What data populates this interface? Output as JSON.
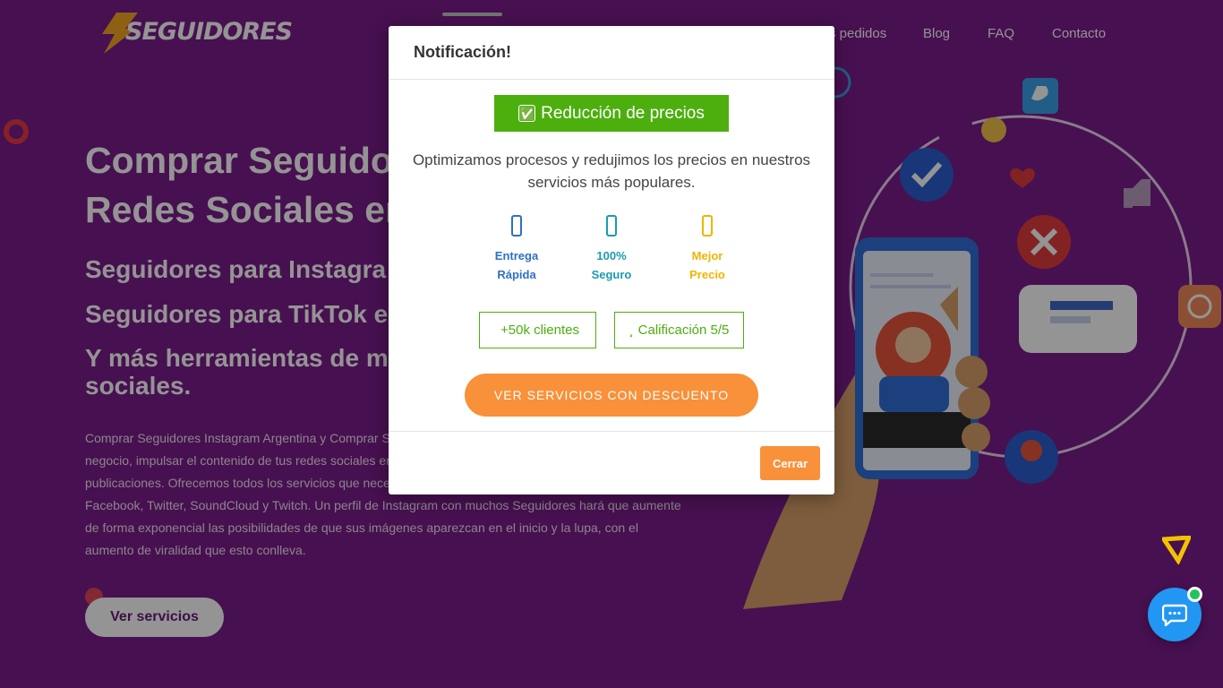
{
  "brand": {
    "logo_text": "SEGUIDORES"
  },
  "nav": {
    "items": [
      "s pedidos",
      "Blog",
      "FAQ",
      "Contacto"
    ]
  },
  "hero": {
    "title_line1": "Comprar Seguidor",
    "title_line2": "Redes Sociales en",
    "sub1": "Seguidores para Instagra",
    "sub2": "Seguidores para TikTok e",
    "sub3a": "Y más herramientas de m",
    "sub3b": "sociales.",
    "paragraph_lines": [
      "Comprar Seguidores Instagram Argentina y Comprar S",
      "negocio, impulsar el contenido de tus redes sociales en",
      "publicaciones. Ofrecemos todos los servicios que nece",
      "Facebook, Twitter, SoundCloud y Twitch. Un perfil de Instagram con muchos Seguidores hará que aumente",
      "de forma exponencial las posibilidades de que sus imágenes aparezcan en el inicio y la lupa, con el",
      "aumento de viralidad que esto conlleva."
    ],
    "button_label": "Ver servicios"
  },
  "modal": {
    "title": "Notificación!",
    "close_glyph": "",
    "badge_emoji": "✅",
    "badge_label": "Reducción de precios",
    "text": "Optimizamos procesos y redujimos los precios en nuestros servicios más populares.",
    "features": [
      {
        "icon": "rocket-icon",
        "line1": "Entrega",
        "line2": "Rápida",
        "color": "#2f6fc4"
      },
      {
        "icon": "shield-icon",
        "line1": "100%",
        "line2": "Seguro",
        "color": "#1a9bb0"
      },
      {
        "icon": "tag-icon",
        "line1": "Mejor",
        "line2": "Precio",
        "color": "#f0b400"
      }
    ],
    "stats": [
      {
        "icon": "users-icon",
        "label": "+50k clientes"
      },
      {
        "icon": "star-icon",
        "label": "Calificación 5/5"
      }
    ],
    "cta_label": "VER SERVICIOS CON DESCUENTO",
    "footer_close_label": "Cerrar"
  },
  "colors": {
    "accent_green": "#4caf0e",
    "accent_orange": "#f8913a",
    "bg_purple": "#7a1d8a",
    "chat_blue": "#2196f3"
  }
}
